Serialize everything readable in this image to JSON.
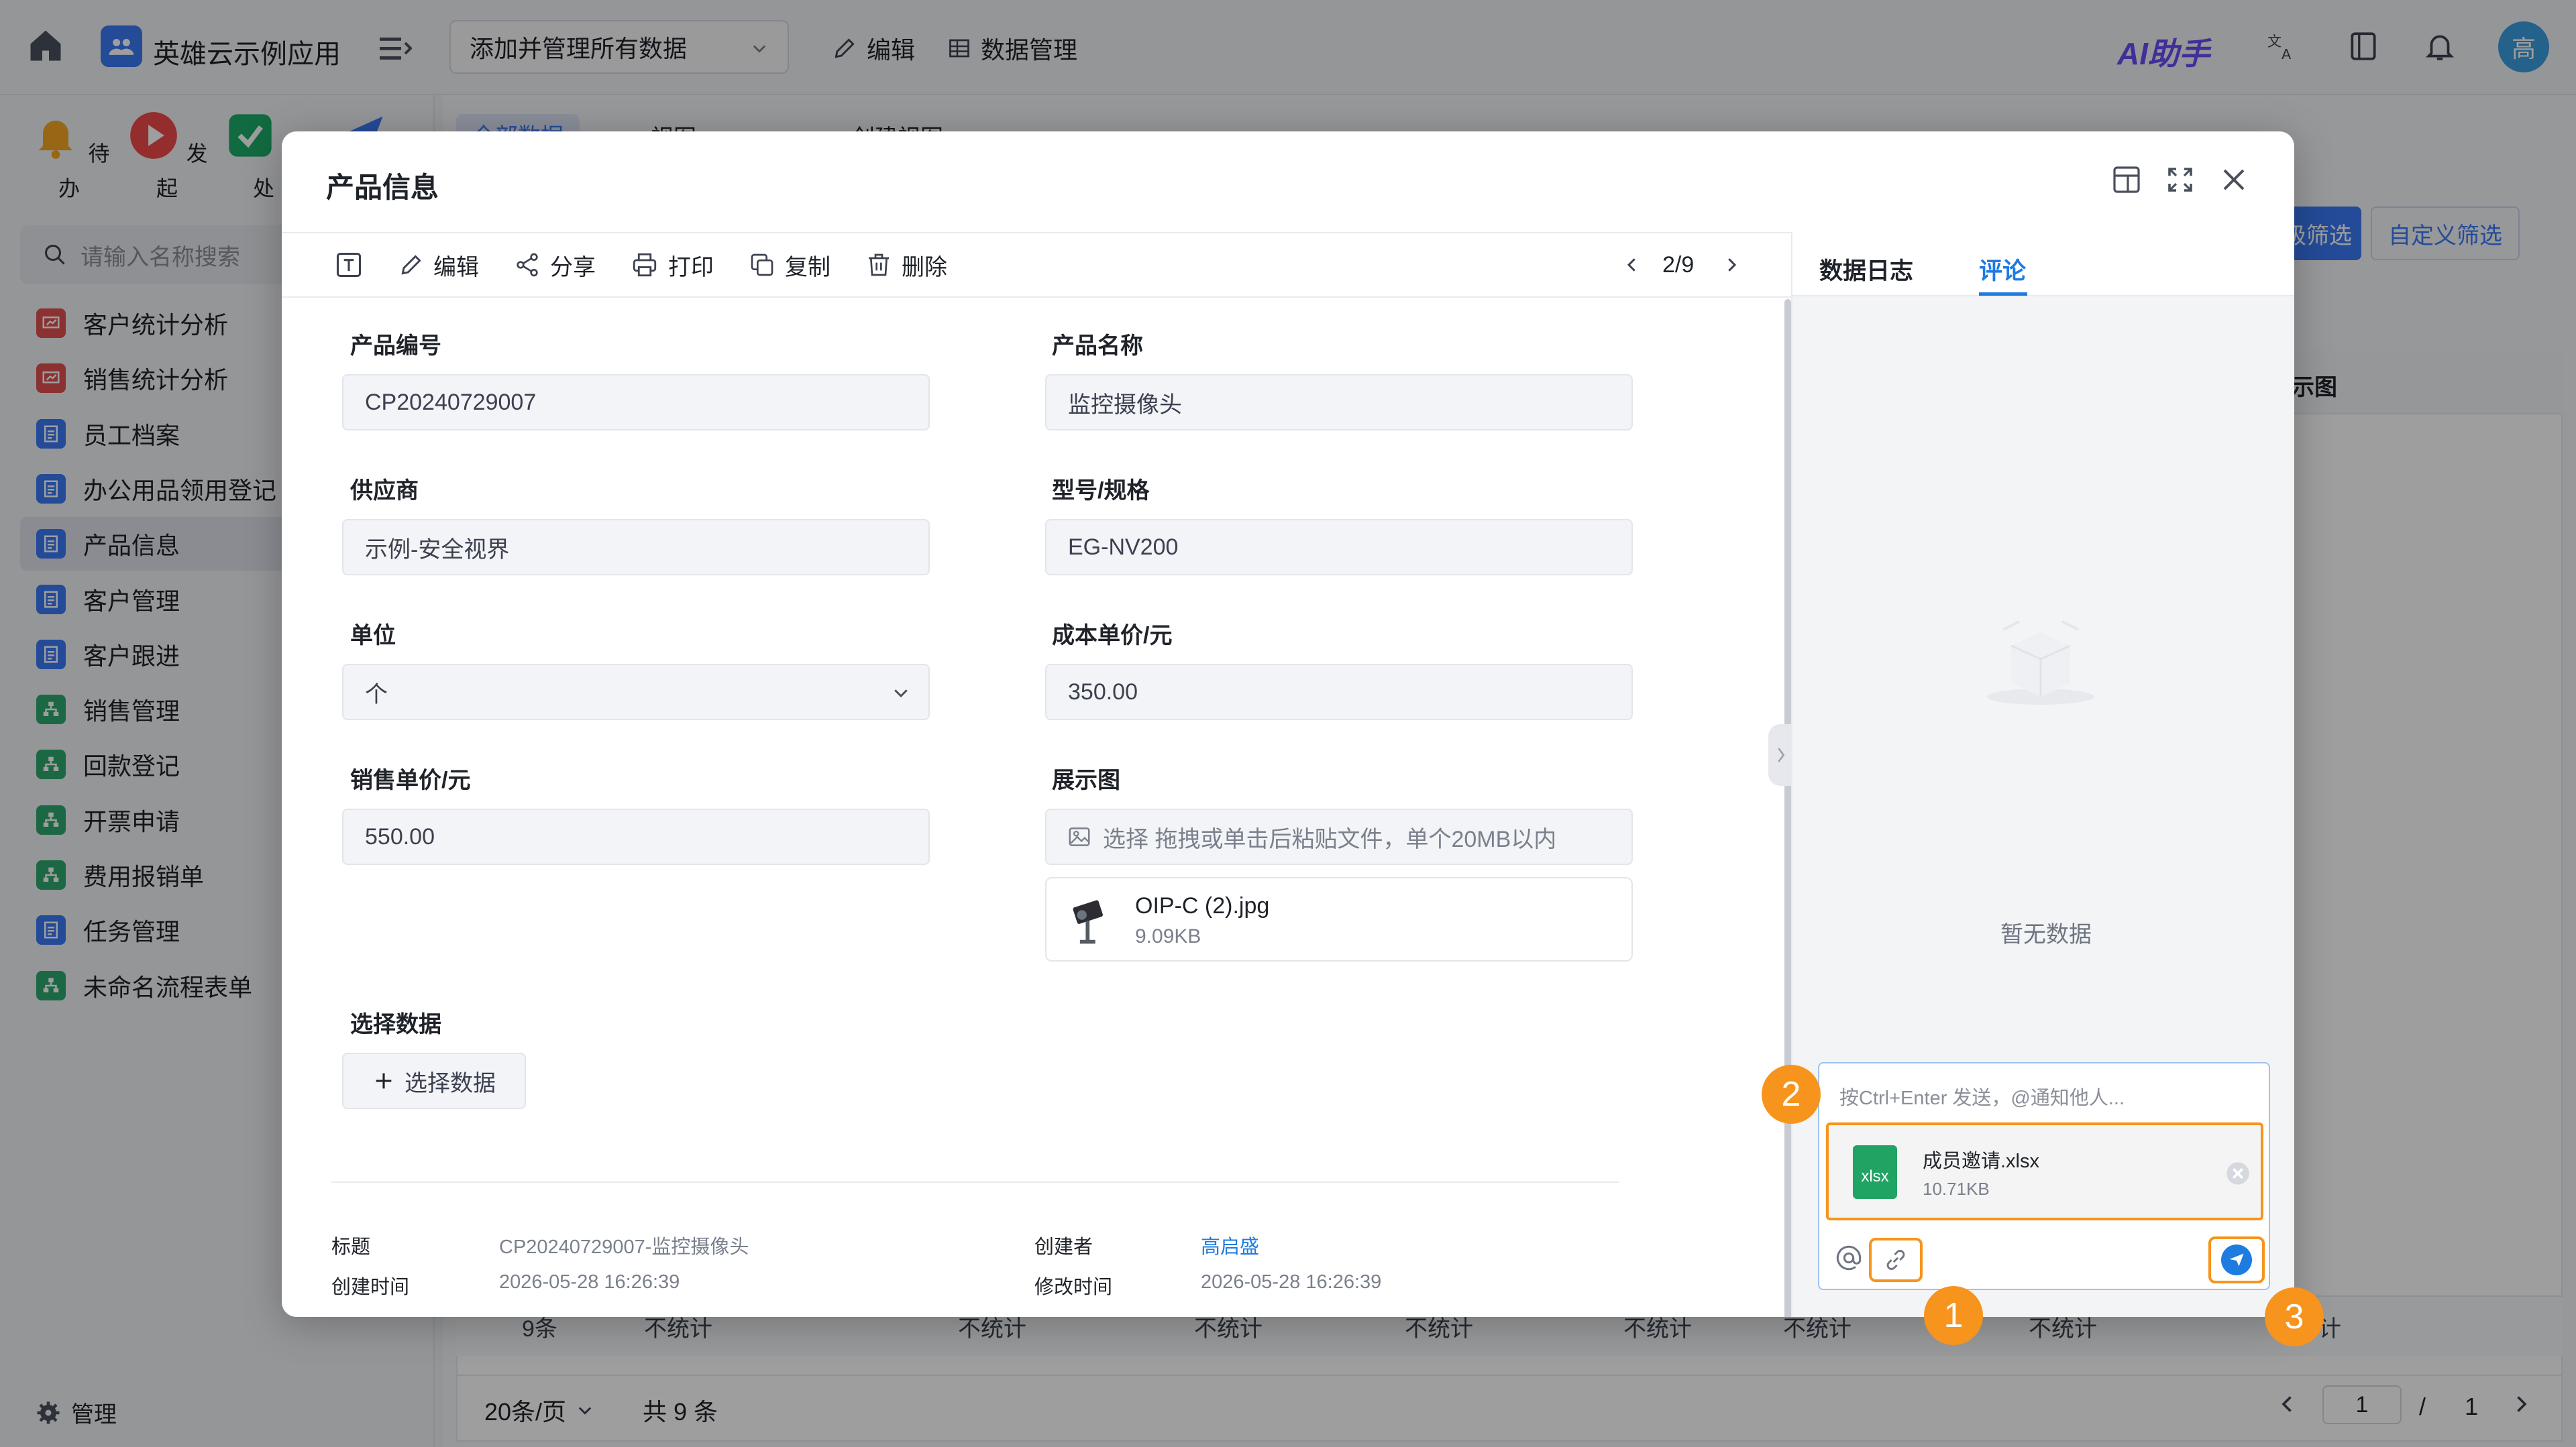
{
  "topbar": {
    "app_name": "英雄云示例应用",
    "view_select": "添加并管理所有数据",
    "edit_label": "编辑",
    "data_manage_label": "数据管理",
    "ai_label": "AI助手",
    "avatar_text": "高"
  },
  "quick_actions": [
    {
      "label": "待办",
      "icon": "bell-icon"
    },
    {
      "label": "发起",
      "icon": "play-icon"
    },
    {
      "label": "已处",
      "icon": "done-icon"
    },
    {
      "label": "",
      "icon": "send-icon"
    }
  ],
  "sidebar": {
    "search_placeholder": "请输入名称搜索",
    "items": [
      {
        "label": "客户统计分析",
        "color": "#e04f52"
      },
      {
        "label": "销售统计分析",
        "color": "#e04f52"
      },
      {
        "label": "员工档案",
        "color": "#3b79f5"
      },
      {
        "label": "办公用品领用登记",
        "color": "#3b79f5"
      },
      {
        "label": "产品信息",
        "color": "#3b79f5",
        "active": true
      },
      {
        "label": "客户管理",
        "color": "#3b79f5"
      },
      {
        "label": "客户跟进",
        "color": "#3b79f5"
      },
      {
        "label": "销售管理",
        "color": "#2fa86e"
      },
      {
        "label": "回款登记",
        "color": "#2fa86e"
      },
      {
        "label": "开票申请",
        "color": "#2fa86e"
      },
      {
        "label": "费用报销单",
        "color": "#2fa86e"
      },
      {
        "label": "任务管理",
        "color": "#3b79f5"
      },
      {
        "label": "未命名流程表单",
        "color": "#2fa86e"
      }
    ],
    "manage_label": "管理"
  },
  "background": {
    "tabs": [
      "全部数据",
      "视图",
      "创建视图"
    ],
    "filter_active": "级筛选",
    "filter_custom": "自定义筛选",
    "column_header": "示图",
    "footer_count": "9条",
    "footer_stat": "不统计",
    "footer_stat_partial": "计",
    "page_size": "20条/页",
    "total": "共 9 条",
    "page_current": "1",
    "page_sep": "/",
    "page_total": "1"
  },
  "modal": {
    "title": "产品信息",
    "toolbar": {
      "edit": "编辑",
      "share": "分享",
      "print": "打印",
      "copy": "复制",
      "delete": "删除",
      "pager": "2/9"
    },
    "fields": {
      "code_label": "产品编号",
      "code_value": "CP20240729007",
      "name_label": "产品名称",
      "name_value": "监控摄像头",
      "supplier_label": "供应商",
      "supplier_value": "示例-安全视界",
      "model_label": "型号/规格",
      "model_value": "EG-NV200",
      "unit_label": "单位",
      "unit_value": "个",
      "cost_label": "成本单价/元",
      "cost_value": "350.00",
      "price_label": "销售单价/元",
      "price_value": "550.00",
      "image_label": "展示图",
      "image_upload_hint": "选择 拖拽或单击后粘贴文件，单个20MB以内",
      "image_file_name": "OIP-C (2).jpg",
      "image_file_size": "9.09KB",
      "select_data_label": "选择数据",
      "select_data_button": "选择数据"
    },
    "meta": {
      "title_label": "标题",
      "title_value": "CP20240729007-监控摄像头",
      "creator_label": "创建者",
      "creator_value": "高启盛",
      "created_label": "创建时间",
      "created_value": "2026-05-28 16:26:39",
      "modified_label": "修改时间",
      "modified_value": "2026-05-28 16:26:39"
    },
    "side": {
      "tab_log": "数据日志",
      "tab_comment": "评论",
      "empty_text": "暂无数据",
      "comment_placeholder": "按Ctrl+Enter 发送，@通知他人...",
      "attach_name": "成员邀请.xlsx",
      "attach_size": "10.71KB",
      "attach_ext": "xlsx"
    }
  },
  "callouts": [
    "1",
    "2",
    "3"
  ],
  "colors": {
    "accent": "#1e7be0",
    "callout": "#f7941d",
    "excel": "#21a463"
  }
}
